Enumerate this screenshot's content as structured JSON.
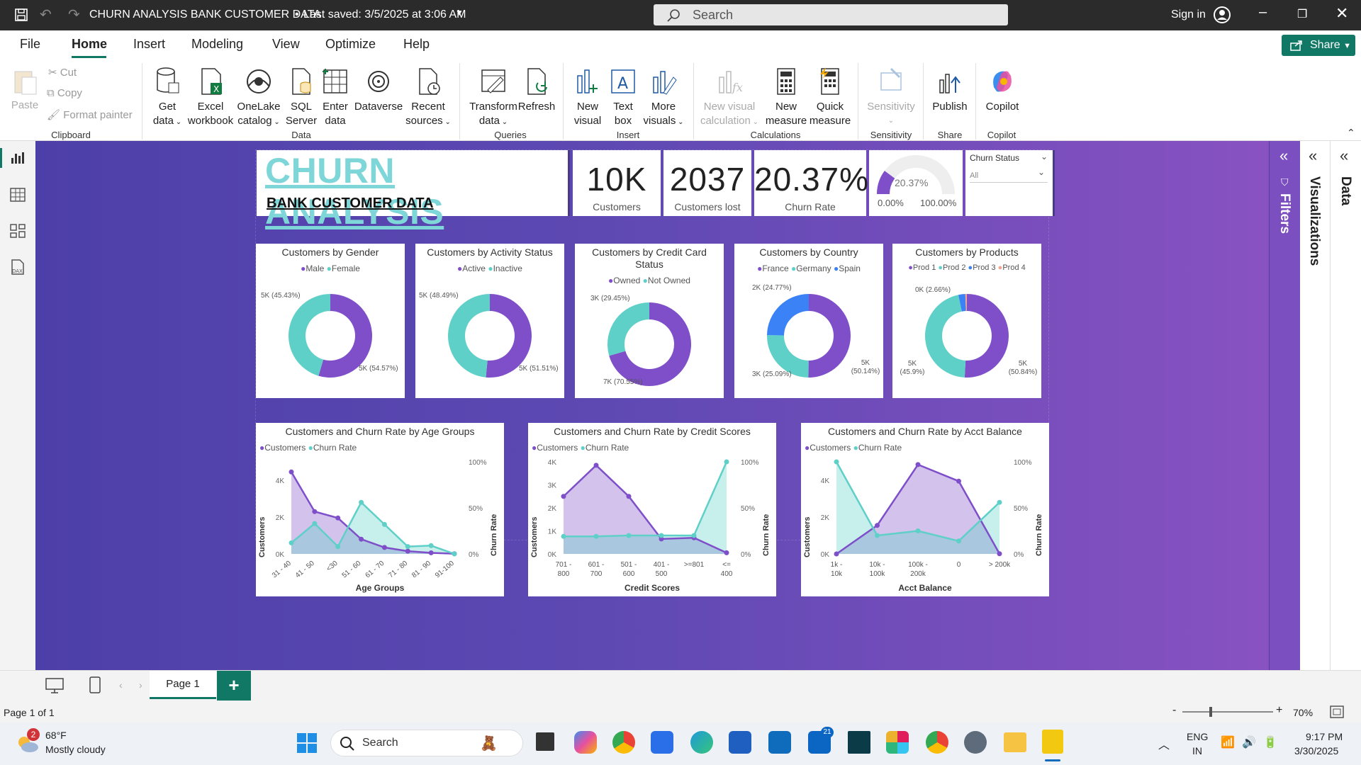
{
  "titlebar": {
    "doc_title": "CHURN ANALYSIS BANK CUSTOMER DATA",
    "last_saved": "Last saved: 3/5/2025 at 3:06 AM",
    "search_placeholder": "Search",
    "sign_in": "Sign in"
  },
  "menu": {
    "items": [
      "File",
      "Home",
      "Insert",
      "Modeling",
      "View",
      "Optimize",
      "Help"
    ],
    "active": "Home",
    "share": "Share"
  },
  "ribbon": {
    "clipboard": {
      "paste": "Paste",
      "cut": "Cut",
      "copy": "Copy",
      "format_painter": "Format painter",
      "group": "Clipboard"
    },
    "data": {
      "get_data": [
        "Get",
        "data"
      ],
      "excel": [
        "Excel",
        "workbook"
      ],
      "onelake": [
        "OneLake",
        "catalog"
      ],
      "sql": [
        "SQL",
        "Server"
      ],
      "enter": [
        "Enter",
        "data"
      ],
      "dataverse": "Dataverse",
      "recent": [
        "Recent",
        "sources"
      ],
      "group": "Data"
    },
    "queries": {
      "transform": [
        "Transform",
        "data"
      ],
      "refresh": "Refresh",
      "group": "Queries"
    },
    "insert": {
      "new_visual": [
        "New",
        "visual"
      ],
      "text_box": [
        "Text",
        "box"
      ],
      "more_visuals": [
        "More",
        "visuals"
      ],
      "group": "Insert"
    },
    "calculations": {
      "new_visual_calc": [
        "New visual",
        "calculation"
      ],
      "new_measure": [
        "New",
        "measure"
      ],
      "quick_measure": [
        "Quick",
        "measure"
      ],
      "group": "Calculations"
    },
    "sensitivity": {
      "label": "Sensitivity",
      "group": "Sensitivity"
    },
    "share": {
      "publish": "Publish",
      "group": "Share"
    },
    "copilot": {
      "label": "Copilot",
      "group": "Copilot"
    }
  },
  "panes": {
    "filters": "Filters",
    "visualizations": "Visualizations",
    "data": "Data"
  },
  "report": {
    "title": "CHURN ANALYSIS",
    "subtitle": "BANK CUSTOMER DATA",
    "kpis": [
      {
        "value": "10K",
        "label": "Customers"
      },
      {
        "value": "2037",
        "label": "Customers lost"
      },
      {
        "value": "20.37%",
        "label": "Churn Rate"
      }
    ],
    "gauge": {
      "value": "20.37%",
      "min": "0.00%",
      "max": "100.00%",
      "fraction": 0.2037
    },
    "slicer": {
      "title": "Churn Status",
      "value": "All"
    },
    "colors": {
      "purple": "#7e4fc9",
      "teal": "#5fd0c8",
      "blue": "#3b82f6",
      "salmon": "#f4a48c"
    }
  },
  "chart_data": [
    {
      "type": "pie",
      "title": "Customers by Gender",
      "legend": [
        "Male",
        "Female"
      ],
      "values": [
        5457,
        4543
      ],
      "labels": [
        "5K (54.57%)",
        "5K (45.43%)"
      ]
    },
    {
      "type": "pie",
      "title": "Customers by Activity Status",
      "legend": [
        "Active",
        "Inactive"
      ],
      "values": [
        5151,
        4849
      ],
      "labels": [
        "5K (51.51%)",
        "5K (48.49%)"
      ]
    },
    {
      "type": "pie",
      "title": "Customers by Credit Card Status",
      "legend": [
        "Owned",
        "Not Owned"
      ],
      "values": [
        7055,
        2945
      ],
      "labels": [
        "7K (70.55%)",
        "3K (29.45%)"
      ]
    },
    {
      "type": "pie",
      "title": "Customers by Country",
      "legend": [
        "France",
        "Germany",
        "Spain"
      ],
      "values": [
        5014,
        2509,
        2477
      ],
      "labels": [
        "5K (50.14%)",
        "3K (25.09%)",
        "2K (24.77%)"
      ]
    },
    {
      "type": "pie",
      "title": "Customers by Products",
      "legend": [
        "Prod 1",
        "Prod 2",
        "Prod 3",
        "Prod 4"
      ],
      "values": [
        5084,
        4590,
        266,
        60
      ],
      "labels": [
        "5K (50.84%)",
        "5K (45.9%)",
        "0K (2.66%)",
        ""
      ]
    },
    {
      "type": "area",
      "title": "Customers and Churn Rate by Age Groups",
      "xlabel": "Age Groups",
      "ylabel": "Customers",
      "y2label": "Churn Rate",
      "legend": [
        "Customers",
        "Churn Rate"
      ],
      "categories": [
        "31 - 40",
        "41 - 50",
        "<30",
        "51 - 60",
        "61 - 70",
        "71 - 80",
        "81 - 90",
        "91-100"
      ],
      "customers": [
        4450,
        2300,
        1950,
        800,
        350,
        150,
        60,
        10
      ],
      "churn_rate": [
        0.12,
        0.33,
        0.08,
        0.56,
        0.32,
        0.08,
        0.09,
        0.0
      ],
      "yticks": [
        "0K",
        "2K",
        "4K"
      ],
      "y2ticks": [
        "0%",
        "50%",
        "100%"
      ],
      "ymax": 5000
    },
    {
      "type": "area",
      "title": "Customers and Churn Rate by Credit Scores",
      "xlabel": "Credit Scores",
      "ylabel": "Customers",
      "y2label": "Churn Rate",
      "legend": [
        "Customers",
        "Churn Rate"
      ],
      "categories": [
        "701 - 800",
        "601 - 700",
        "501 - 600",
        "401 - 500",
        ">=801",
        "<= 400"
      ],
      "customers": [
        2500,
        3850,
        2500,
        650,
        700,
        50
      ],
      "churn_rate": [
        0.19,
        0.19,
        0.2,
        0.2,
        0.2,
        1.0
      ],
      "yticks": [
        "0K",
        "1K",
        "2K",
        "3K",
        "4K"
      ],
      "y2ticks": [
        "0%",
        "50%",
        "100%"
      ],
      "ymax": 4000
    },
    {
      "type": "area",
      "title": "Customers and Churn Rate by Acct Balance",
      "xlabel": "Acct Balance",
      "ylabel": "Customers",
      "y2label": "Churn Rate",
      "legend": [
        "Customers",
        "Churn Rate"
      ],
      "categories": [
        "1k - 10k",
        "10k - 100k",
        "100k - 200k",
        "0",
        "> 200k"
      ],
      "customers": [
        0,
        1550,
        4850,
        3950,
        10
      ],
      "churn_rate": [
        1.0,
        0.2,
        0.25,
        0.14,
        0.56
      ],
      "yticks": [
        "0K",
        "2K",
        "4K"
      ],
      "y2ticks": [
        "0%",
        "50%",
        "100%"
      ],
      "ymax": 5000
    }
  ],
  "pages": {
    "tab": "Page 1",
    "status": "Page 1 of 1",
    "zoom": "70%"
  },
  "taskbar": {
    "temp": "68°F",
    "weather": "Mostly cloudy",
    "badge": "2",
    "search": "Search",
    "lang1": "ENG",
    "lang2": "IN",
    "time": "9:17 PM",
    "date": "3/30/2025",
    "notif": "21"
  }
}
